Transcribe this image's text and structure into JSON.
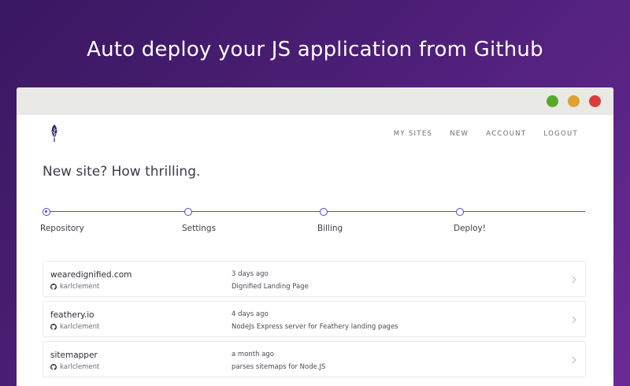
{
  "headline": "Auto deploy your JS application from Github",
  "nav": {
    "items": [
      "MY SITES",
      "NEW",
      "ACCOUNT",
      "LOGOUT"
    ]
  },
  "page_title": "New site? How thrilling.",
  "steps": [
    {
      "label": "Repository",
      "active": true
    },
    {
      "label": "Settings",
      "active": false
    },
    {
      "label": "Billing",
      "active": false
    },
    {
      "label": "Deploy!",
      "active": false
    }
  ],
  "sites": [
    {
      "name": "wearedignified.com",
      "user": "karlclement",
      "time": "3 days ago",
      "description": "Dignified Landing Page"
    },
    {
      "name": "feathery.io",
      "user": "karlclement",
      "time": "4 days ago",
      "description": "NodeJs Express server for Feathery landing pages"
    },
    {
      "name": "sitemapper",
      "user": "karlclement",
      "time": "a month ago",
      "description": "parses sitemaps for Node.JS"
    }
  ],
  "colors": {
    "accent": "#5643c9",
    "logo": "#2f2566",
    "window_green": "#58a82a",
    "window_yellow": "#dea132",
    "window_red": "#de3b3b"
  },
  "icons": {
    "logo": "feather-logo",
    "user": "github-icon",
    "row_action": "chevron-right-icon"
  }
}
